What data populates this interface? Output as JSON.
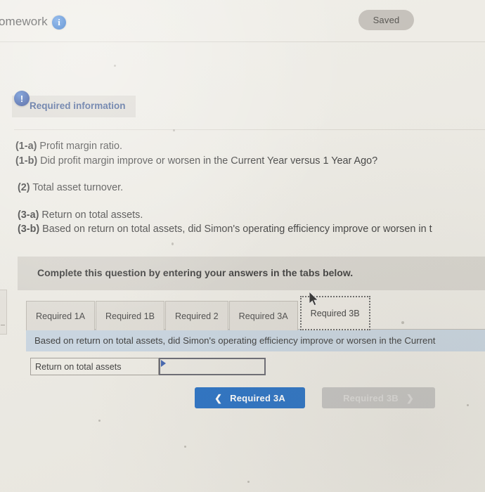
{
  "topbar": {
    "title": "omework",
    "info_icon": "info-circle-icon",
    "saved_label": "Saved"
  },
  "required_info": {
    "alert_icon": "alert-circle-icon",
    "label": "Required information"
  },
  "questions": [
    {
      "num": "(1-a)",
      "text": " Profit margin ratio."
    },
    {
      "num": "(1-b)",
      "text": " Did profit margin improve or worsen in the Current Year versus 1 Year Ago?"
    },
    {
      "num": "(2)",
      "text": " Total asset turnover."
    },
    {
      "num": "(3-a)",
      "text": " Return on total assets."
    },
    {
      "num": "(3-b)",
      "text": " Based on return on total assets, did Simon's operating efficiency improve or worsen in t"
    }
  ],
  "instruction": {
    "text": "Complete this question by entering your answers in the tabs below."
  },
  "tabs": [
    {
      "label": "Required 1A",
      "active": false
    },
    {
      "label": "Required 1B",
      "active": false
    },
    {
      "label": "Required 2",
      "active": false
    },
    {
      "label": "Required 3A",
      "active": false
    },
    {
      "label": "Required 3B",
      "active": true
    }
  ],
  "panel": {
    "question": "Based on return on total assets, did Simon's operating efficiency improve or worsen in the Current",
    "row_label": "Return on total assets",
    "row_value": "",
    "row_placeholder": ""
  },
  "nav": {
    "prev_label": "Required 3A",
    "prev_chevron": "chevron-left-icon",
    "next_label": "Required 3B",
    "next_chevron": "chevron-right-icon"
  },
  "colors": {
    "accent_blue": "#1565c0",
    "panel_blue": "#c5d3e0",
    "page_bg": "#eceae3",
    "disabled_gray": "#c0bfbd",
    "banner_gray": "#d5d2cb"
  }
}
